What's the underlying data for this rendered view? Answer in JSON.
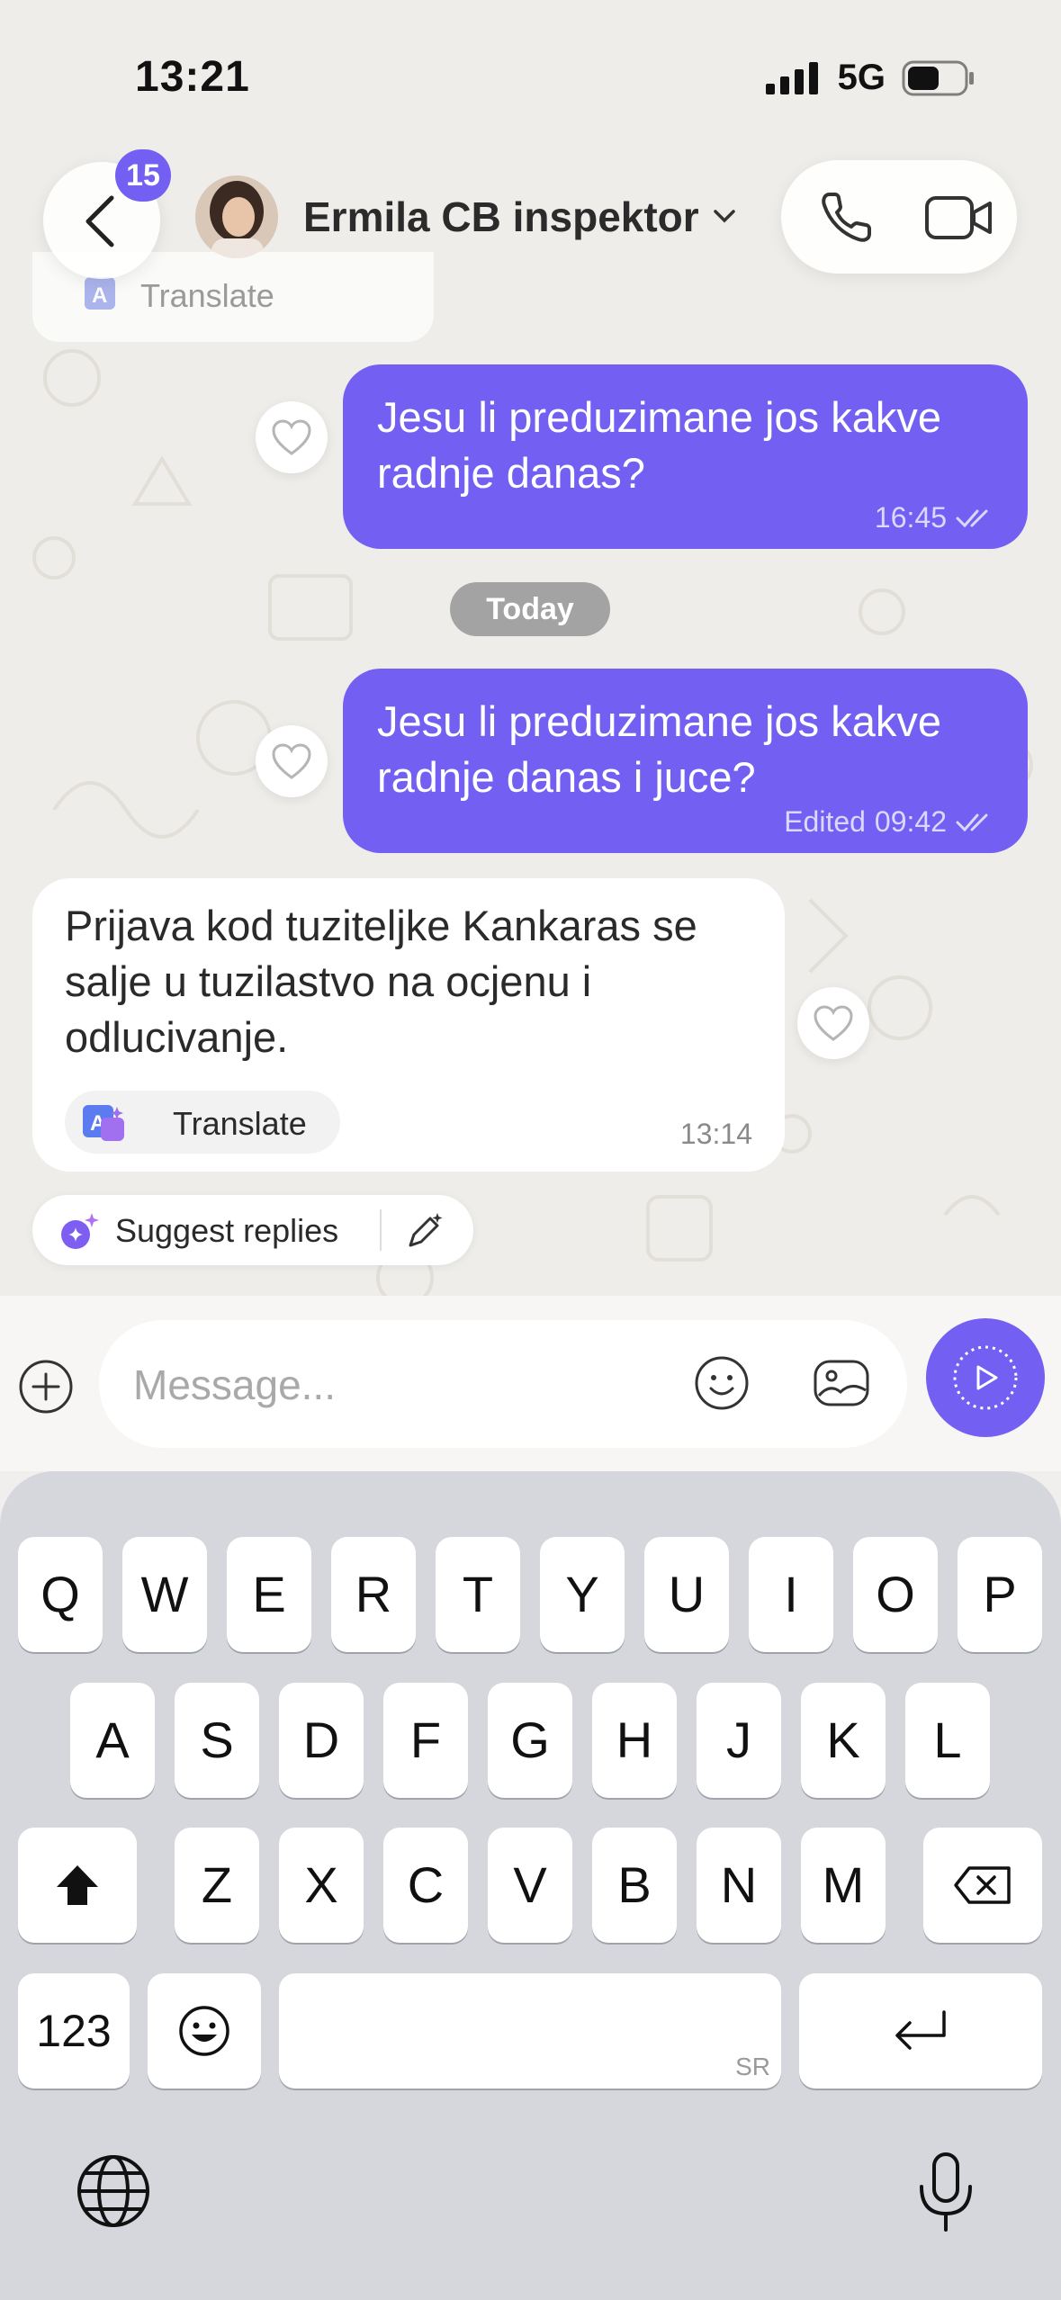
{
  "status_bar": {
    "time": "13:21",
    "network": "5G"
  },
  "header": {
    "unread_count": "15",
    "contact_name": "Ermila CB inspektor"
  },
  "previous_translate_label": "Translate",
  "messages": [
    {
      "direction": "outgoing",
      "text": "Jesu li preduzimane jos kakve radnje danas?",
      "time": "16:45",
      "edited_label": ""
    },
    {
      "direction": "outgoing",
      "text": "Jesu li preduzimane jos kakve radnje danas i juce?",
      "time": "09:42",
      "edited_label": "Edited"
    },
    {
      "direction": "incoming",
      "text": "Prijava kod tuziteljke Kankaras se salje u tuzilastvo na ocjenu i odlucivanje.",
      "time": "13:14",
      "translate_label": "Translate"
    }
  ],
  "date_separator": "Today",
  "suggest_replies_label": "Suggest replies",
  "composer": {
    "placeholder": "Message..."
  },
  "keyboard": {
    "row1": [
      "Q",
      "W",
      "E",
      "R",
      "T",
      "Y",
      "U",
      "I",
      "O",
      "P"
    ],
    "row2": [
      "A",
      "S",
      "D",
      "F",
      "G",
      "H",
      "J",
      "K",
      "L"
    ],
    "row3": [
      "Z",
      "X",
      "C",
      "V",
      "B",
      "N",
      "M"
    ],
    "numbers_key": "123",
    "language": "SR"
  },
  "colors": {
    "accent": "#7360f2",
    "chat_bg": "#efedea",
    "keyboard_bg": "#d5d7dd"
  }
}
